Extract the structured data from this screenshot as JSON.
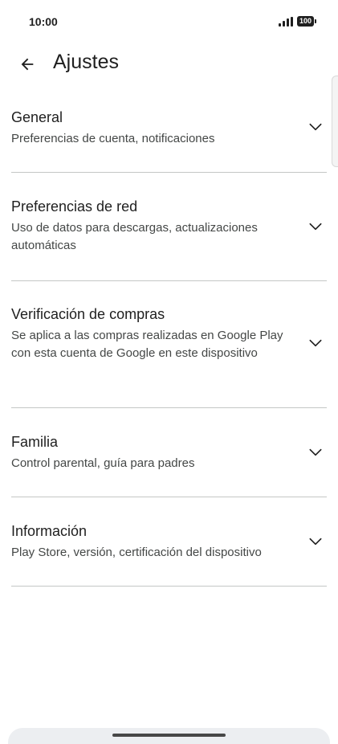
{
  "status_bar": {
    "time": "10:00",
    "battery": "100",
    "signal_icon": "signal-bars-icon"
  },
  "header": {
    "back_icon": "arrow-back-icon",
    "title": "Ajustes"
  },
  "settings": [
    {
      "title": "General",
      "subtitle": "Preferencias de cuenta, notificaciones",
      "icon": "chevron-down-icon"
    },
    {
      "title": "Preferencias de red",
      "subtitle": "Uso de datos para descargas, actualizaciones automáticas",
      "icon": "chevron-down-icon"
    },
    {
      "title": "Verificación de compras",
      "subtitle": "Se aplica a las compras realizadas en Google Play con esta cuenta de Google en este dispositivo",
      "icon": "chevron-down-icon"
    },
    {
      "title": "Familia",
      "subtitle": "Control parental, guía para padres",
      "icon": "chevron-down-icon"
    },
    {
      "title": "Información",
      "subtitle": "Play Store, versión, certificación del dispositivo",
      "icon": "chevron-down-icon"
    }
  ],
  "colors": {
    "text_primary": "#1f1f1f",
    "text_secondary": "#444746",
    "divider": "#c4c7c5",
    "background": "#ffffff"
  }
}
